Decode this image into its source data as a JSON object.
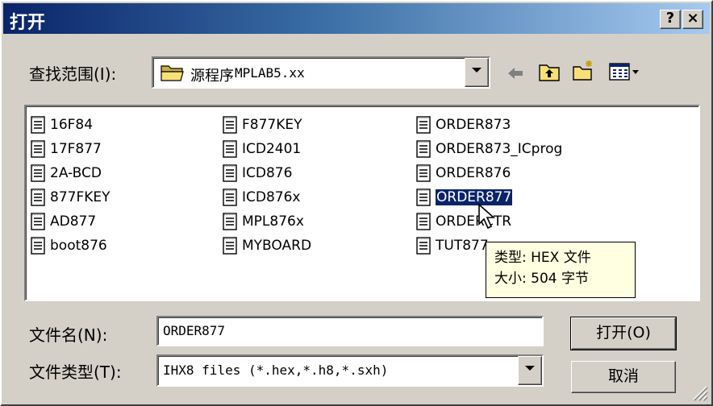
{
  "window": {
    "title": "打开",
    "help_label": "?",
    "close_label": "×"
  },
  "look_in": {
    "label": "查找范围(I):",
    "value_prefix": "源程序",
    "value_suffix": "MPLAB5.xx"
  },
  "toolbar": {
    "icons": [
      "back-arrow-icon",
      "up-folder-icon",
      "new-folder-icon",
      "view-menu-icon"
    ]
  },
  "files": {
    "columns": [
      [
        "16F84",
        "17F877",
        "2A-BCD",
        "877FKEY",
        "AD877",
        "boot876"
      ],
      [
        "F877KEY",
        "ICD2401",
        "ICD876",
        "ICD876x",
        "MPL876x",
        "MYBOARD"
      ],
      [
        "ORDER873",
        "ORDER873_ICprog",
        "ORDER876",
        "ORDER877",
        "ORDERCTR",
        "TUT877"
      ]
    ],
    "selected": "ORDER877"
  },
  "tooltip": {
    "type_line": "类型: HEX 文件",
    "size_line": "大小: 504 字节"
  },
  "filename": {
    "label": "文件名(N):",
    "value": "ORDER877"
  },
  "filetype": {
    "label": "文件类型(T):",
    "value": "IHX8 files (*.hex,*.h8,*.sxh)"
  },
  "buttons": {
    "open": "打开(O)",
    "cancel": "取消"
  },
  "colors": {
    "title_gradient_start": "#0a246a",
    "title_gradient_end": "#a6caf0",
    "selection": "#0a246a",
    "tooltip_bg": "#ffffe1",
    "face": "#d4d0c8"
  }
}
